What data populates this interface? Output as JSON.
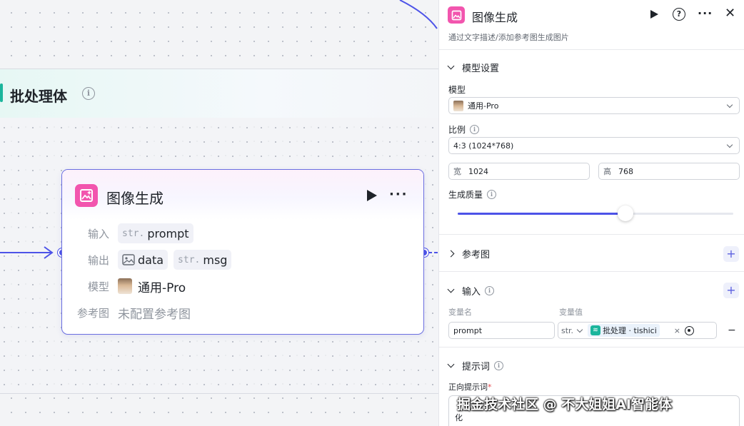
{
  "colors": {
    "accent": "#4d53e8",
    "node_icon": "#f255ae",
    "batch_accent": "#1bb59c"
  },
  "batch": {
    "title": "批处理体",
    "info_icon": "info-icon"
  },
  "node": {
    "title": "图像生成",
    "icon": "image-generate-icon",
    "input_label": "输入",
    "input_chips": [
      {
        "type": "str.",
        "name": "prompt"
      }
    ],
    "output_label": "输出",
    "output_chips": [
      {
        "type": "image-icon",
        "name": "data"
      },
      {
        "type": "str.",
        "name": "msg"
      }
    ],
    "model_label": "模型",
    "model_value": "通用-Pro",
    "ref_label": "参考图",
    "ref_value": "未配置参考图"
  },
  "panel": {
    "title": "图像生成",
    "description": "通过文字描述/添加参考图生成图片",
    "model_section": "模型设置",
    "model_label": "模型",
    "model_value": "通用-Pro",
    "ratio_label": "比例",
    "ratio_value": "4:3 (1024*768)",
    "width_prefix": "宽",
    "width_value": "1024",
    "height_prefix": "高",
    "height_value": "768",
    "quality_label": "生成质量",
    "quality_level": 0.61,
    "ref_section": "参考图",
    "input_section": "输入",
    "var_name_header": "变量名",
    "var_value_header": "变量值",
    "var_name": "prompt",
    "var_type": "str.",
    "var_ref": "批处理 · tishici",
    "prompt_section": "提示词",
    "positive_label": "正向提示词",
    "required_mark": "*",
    "textarea_text": "化"
  },
  "watermark": "掘金技术社区 @ 不大姐姐AI智能体"
}
